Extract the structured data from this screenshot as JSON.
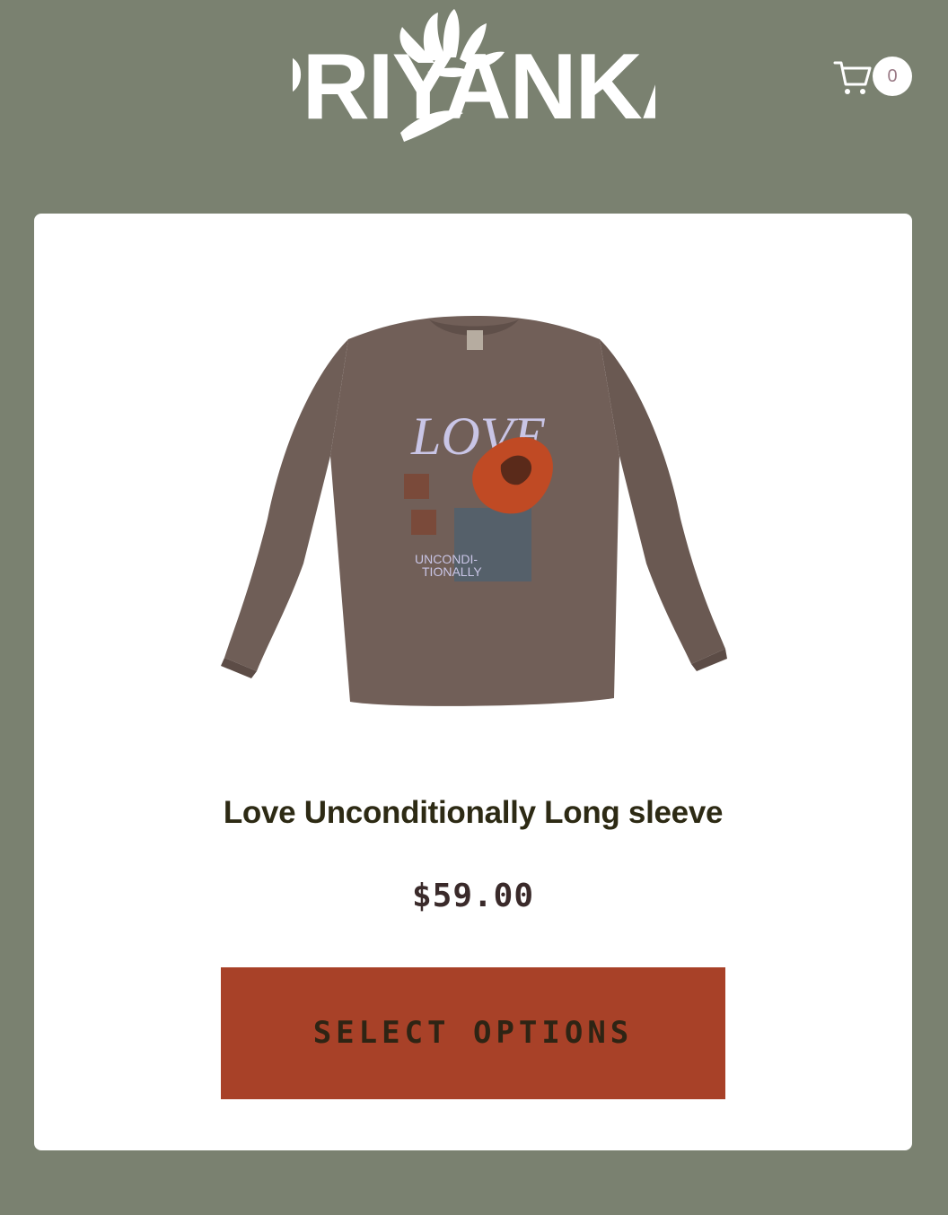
{
  "header": {
    "logo_text": "PRIYANKA",
    "cart_count": "0"
  },
  "product": {
    "title": "Love Unconditionally Long sleeve",
    "price": "$59.00",
    "button_label": "SELECT OPTIONS",
    "image_icon": "long-sleeve-shirt-image",
    "print_text_1": "LOVE",
    "print_text_2": "UNCONDI-",
    "print_text_3": "TIONALLY"
  },
  "colors": {
    "page_bg": "#7a8170",
    "card_bg": "#ffffff",
    "button_bg": "#a84128",
    "title_color": "#2d2a14",
    "shirt_color": "#6f5e57"
  }
}
